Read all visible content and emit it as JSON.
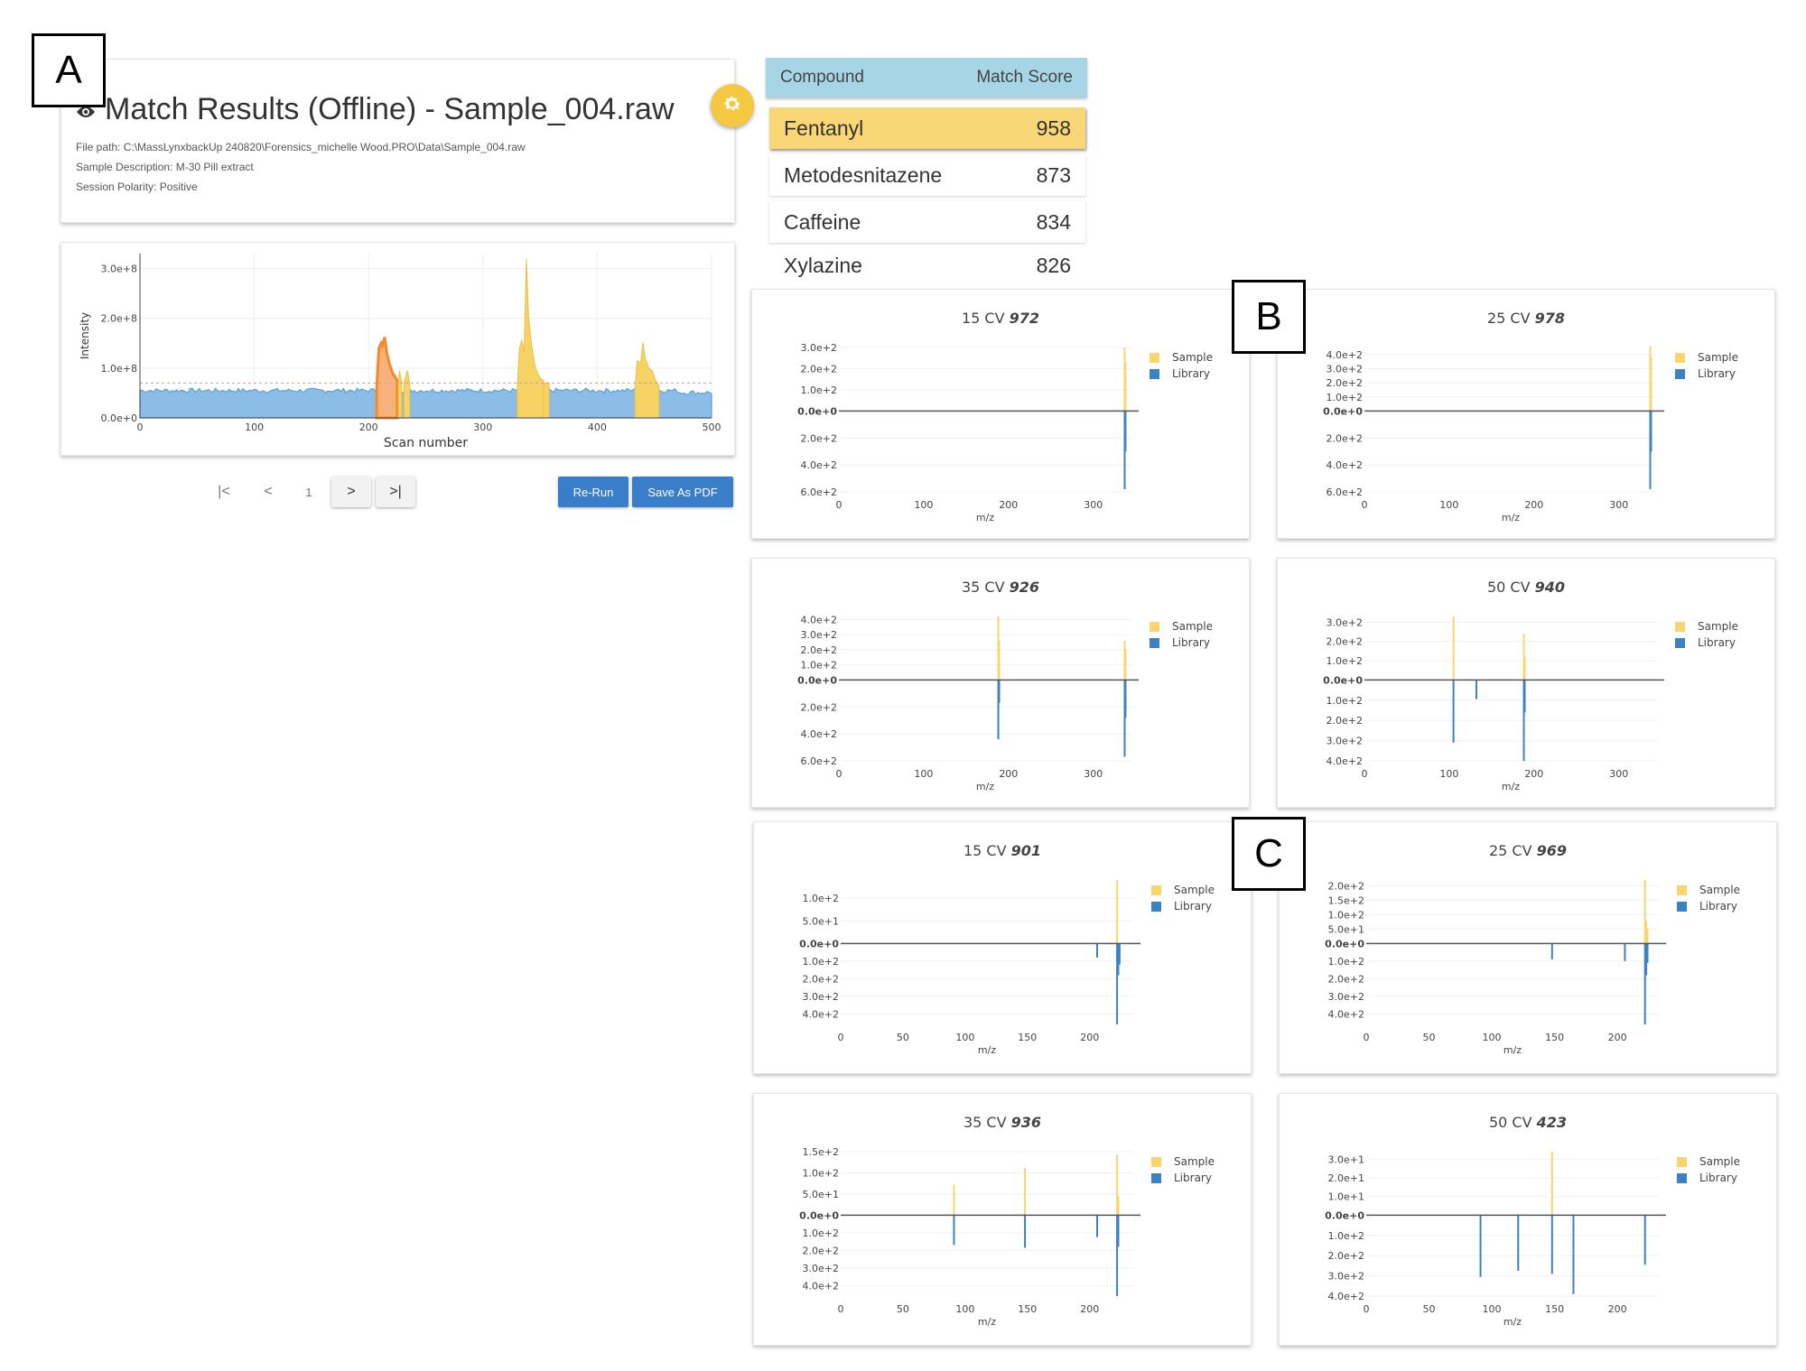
{
  "panel_labels": [
    "A",
    "B",
    "C"
  ],
  "header": {
    "title": "Match Results (Offline) - Sample_004.raw",
    "title_icon": "eye-icon",
    "file_path": "File path: C:\\MassLynxbackUp 240820\\Forensics_michelle Wood.PRO\\Data\\Sample_004.raw",
    "sample_description": "Sample Description: M-30 Pill extract",
    "session_polarity": "Session Polarity: Positive",
    "settings_icon": "gear-icon"
  },
  "colors": {
    "sample": "#f9d56e",
    "library": "#3b82c4",
    "chrom_base": "#8bbde6",
    "chrom_line": "#5a9fd6",
    "highlight_orange": "#f08a2c",
    "highlight_yellow": "#f7d264",
    "accent_button": "#3a7dc9",
    "table_header": "#a6d5e6",
    "selected_row": "#f9d777"
  },
  "pagination": {
    "first_icon": "first-page-icon",
    "prev_icon": "prev-page-icon",
    "current_page": "1",
    "next_icon": "next-page-icon",
    "last_icon": "last-page-icon"
  },
  "buttons": {
    "rerun": "Re-Run",
    "save_pdf": "Save As PDF"
  },
  "results_table": {
    "headers": [
      "Compound",
      "Match Score"
    ],
    "rows": [
      {
        "compound": "Fentanyl",
        "score": "958",
        "selected": true
      },
      {
        "compound": "Metodesnitazene",
        "score": "873",
        "selected": false
      },
      {
        "compound": "Caffeine",
        "score": "834",
        "selected": false
      },
      {
        "compound": "Xylazine",
        "score": "826",
        "selected": false
      }
    ]
  },
  "chart_data": [
    {
      "id": "chromatogram",
      "type": "area",
      "title": "",
      "xlabel": "Scan number",
      "ylabel": "Intensity",
      "xlim": [
        0,
        500
      ],
      "ylim": [
        0,
        330000000.0
      ],
      "xticks": [
        "0",
        "100",
        "200",
        "300",
        "400",
        "500"
      ],
      "yticks": [
        {
          "v": 0,
          "label": "0.0e+0"
        },
        {
          "v": 100000000.0,
          "label": "1.0e+8"
        },
        {
          "v": 200000000.0,
          "label": "2.0e+8"
        },
        {
          "v": 300000000.0,
          "label": "3.0e+8"
        }
      ],
      "threshold": 70000000.0,
      "baseline": 55000000.0,
      "grid": true,
      "highlight_regions": [
        {
          "start": 207,
          "end": 225,
          "color": "orange",
          "peak": [
            [
              207,
              60000000.0
            ],
            [
              209,
              140000000.0
            ],
            [
              211,
              150000000.0
            ],
            [
              212,
              145000000.0
            ],
            [
              214,
              162000000.0
            ],
            [
              216,
              130000000.0
            ],
            [
              218,
              110000000.0
            ],
            [
              221,
              90000000.0
            ],
            [
              225,
              75000000.0
            ]
          ]
        },
        {
          "start": 226,
          "end": 229,
          "color": "yellow",
          "peak": [
            [
              226,
              70000000.0
            ],
            [
              227,
              95000000.0
            ],
            [
              229,
              70000000.0
            ]
          ]
        },
        {
          "start": 231,
          "end": 236,
          "color": "yellow",
          "peak": [
            [
              231,
              70000000.0
            ],
            [
              234,
              95000000.0
            ],
            [
              236,
              70000000.0
            ]
          ]
        },
        {
          "start": 330,
          "end": 353,
          "color": "yellow",
          "peak": [
            [
              330,
              60000000.0
            ],
            [
              332,
              140000000.0
            ],
            [
              334,
              157000000.0
            ],
            [
              336,
              130000000.0
            ],
            [
              338,
              320000000.0
            ],
            [
              340,
              200000000.0
            ],
            [
              343,
              140000000.0
            ],
            [
              346,
              100000000.0
            ],
            [
              350,
              80000000.0
            ],
            [
              353,
              75000000.0
            ]
          ]
        },
        {
          "start": 353,
          "end": 358,
          "color": "yellow",
          "peak": [
            [
              353,
              70000000.0
            ],
            [
              356,
              70000000.0
            ],
            [
              358,
              70000000.0
            ]
          ]
        },
        {
          "start": 433,
          "end": 454,
          "color": "yellow",
          "peak": [
            [
              433,
              60000000.0
            ],
            [
              435,
              115000000.0
            ],
            [
              438,
              110000000.0
            ],
            [
              440,
              152000000.0
            ],
            [
              442,
              120000000.0
            ],
            [
              445,
              100000000.0
            ],
            [
              448,
              95000000.0
            ],
            [
              451,
              75000000.0
            ],
            [
              454,
              65000000.0
            ]
          ]
        }
      ]
    },
    {
      "id": "B-15CV",
      "type": "bar",
      "group": "B",
      "title_prefix": "15 CV",
      "score": "972",
      "xlabel": "m/z",
      "xlim": [
        0,
        345
      ],
      "xticks": [
        0,
        100,
        200,
        300
      ],
      "ylim_up": 300,
      "ylim_down": 600,
      "yticks_up": [
        {
          "v": 300,
          "label": "3.0e+2"
        },
        {
          "v": 200,
          "label": "2.0e+2"
        },
        {
          "v": 100,
          "label": "1.0e+2"
        }
      ],
      "yticks_down": [
        {
          "v": 200,
          "label": "2.0e+2"
        },
        {
          "v": 400,
          "label": "4.0e+2"
        },
        {
          "v": 600,
          "label": "6.0e+2",
          "offset_zero": true
        }
      ],
      "legend": [
        "Sample",
        "Library"
      ],
      "sample": [
        {
          "mz": 337,
          "i": 300
        },
        {
          "mz": 338,
          "i": 230
        }
      ],
      "library": [
        {
          "mz": 337,
          "i": 580
        },
        {
          "mz": 338,
          "i": 300
        }
      ]
    },
    {
      "id": "B-25CV",
      "type": "bar",
      "group": "B",
      "title_prefix": "25 CV",
      "score": "978",
      "xlabel": "m/z",
      "xlim": [
        0,
        345
      ],
      "xticks": [
        0,
        100,
        200,
        300
      ],
      "ylim_up": 450,
      "ylim_down": 600,
      "yticks_up": [
        {
          "v": 400,
          "label": "4.0e+2"
        },
        {
          "v": 300,
          "label": "3.0e+2"
        },
        {
          "v": 200,
          "label": "2.0e+2"
        },
        {
          "v": 100,
          "label": "1.0e+2"
        }
      ],
      "yticks_down": [
        {
          "v": 200,
          "label": "2.0e+2"
        },
        {
          "v": 400,
          "label": "4.0e+2"
        },
        {
          "v": 600,
          "label": "6.0e+2",
          "offset_zero": true
        }
      ],
      "legend": [
        "Sample",
        "Library"
      ],
      "sample": [
        {
          "mz": 337,
          "i": 460
        },
        {
          "mz": 338,
          "i": 380
        }
      ],
      "library": [
        {
          "mz": 337,
          "i": 580
        },
        {
          "mz": 338,
          "i": 300
        }
      ]
    },
    {
      "id": "B-35CV",
      "type": "bar",
      "group": "B",
      "title_prefix": "35 CV",
      "score": "926",
      "xlabel": "m/z",
      "xlim": [
        0,
        345
      ],
      "xticks": [
        0,
        100,
        200,
        300
      ],
      "ylim_up": 420,
      "ylim_down": 600,
      "yticks_up": [
        {
          "v": 400,
          "label": "4.0e+2"
        },
        {
          "v": 300,
          "label": "3.0e+2"
        },
        {
          "v": 200,
          "label": "2.0e+2"
        },
        {
          "v": 100,
          "label": "1.0e+2"
        }
      ],
      "yticks_down": [
        {
          "v": 200,
          "label": "2.0e+2"
        },
        {
          "v": 400,
          "label": "4.0e+2"
        },
        {
          "v": 600,
          "label": "6.0e+2",
          "offset_zero": true
        }
      ],
      "legend": [
        "Sample",
        "Library"
      ],
      "sample": [
        {
          "mz": 188,
          "i": 420
        },
        {
          "mz": 189,
          "i": 260
        },
        {
          "mz": 337,
          "i": 260
        },
        {
          "mz": 338,
          "i": 200
        }
      ],
      "library": [
        {
          "mz": 188,
          "i": 440
        },
        {
          "mz": 189,
          "i": 170
        },
        {
          "mz": 337,
          "i": 570
        },
        {
          "mz": 338,
          "i": 280
        }
      ]
    },
    {
      "id": "B-50CV",
      "type": "bar",
      "group": "B",
      "title_prefix": "50 CV",
      "score": "940",
      "xlabel": "m/z",
      "xlim": [
        0,
        345
      ],
      "xticks": [
        0,
        100,
        200,
        300
      ],
      "ylim_up": 330,
      "ylim_down": 400,
      "yticks_up": [
        {
          "v": 300,
          "label": "3.0e+2"
        },
        {
          "v": 200,
          "label": "2.0e+2"
        },
        {
          "v": 100,
          "label": "1.0e+2"
        }
      ],
      "yticks_down": [
        {
          "v": 100,
          "label": "1.0e+2"
        },
        {
          "v": 200,
          "label": "2.0e+2"
        },
        {
          "v": 300,
          "label": "3.0e+2"
        },
        {
          "v": 400,
          "label": "4.0e+2"
        }
      ],
      "legend": [
        "Sample",
        "Library"
      ],
      "sample": [
        {
          "mz": 105,
          "i": 330
        },
        {
          "mz": 188,
          "i": 240
        },
        {
          "mz": 189,
          "i": 120
        }
      ],
      "library": [
        {
          "mz": 105,
          "i": 310
        },
        {
          "mz": 132,
          "i": 95
        },
        {
          "mz": 188,
          "i": 400
        },
        {
          "mz": 189,
          "i": 160
        }
      ]
    },
    {
      "id": "C-15CV",
      "type": "bar",
      "group": "C",
      "title_prefix": "15 CV",
      "score": "901",
      "xlabel": "m/z",
      "xlim": [
        0,
        235
      ],
      "xticks": [
        0,
        50,
        100,
        150,
        200
      ],
      "ylim_up": 140,
      "ylim_down": 460,
      "yticks_up": [
        {
          "v": 100,
          "label": "1.0e+2"
        },
        {
          "v": 50,
          "label": "5.0e+1"
        }
      ],
      "yticks_down": [
        {
          "v": 100,
          "label": "1.0e+2"
        },
        {
          "v": 200,
          "label": "2.0e+2"
        },
        {
          "v": 300,
          "label": "3.0e+2"
        },
        {
          "v": 400,
          "label": "4.0e+2"
        }
      ],
      "legend": [
        "Sample",
        "Library"
      ],
      "sample": [
        {
          "mz": 222,
          "i": 140
        }
      ],
      "library": [
        {
          "mz": 206,
          "i": 80
        },
        {
          "mz": 222,
          "i": 460
        },
        {
          "mz": 223,
          "i": 180
        },
        {
          "mz": 224,
          "i": 120
        }
      ]
    },
    {
      "id": "C-25CV",
      "type": "bar",
      "group": "C",
      "title_prefix": "25 CV",
      "score": "969",
      "xlabel": "m/z",
      "xlim": [
        0,
        233
      ],
      "xticks": [
        0,
        50,
        100,
        150,
        200
      ],
      "ylim_up": 220,
      "ylim_down": 460,
      "yticks_up": [
        {
          "v": 200,
          "label": "2.0e+2"
        },
        {
          "v": 150,
          "label": "1.5e+2"
        },
        {
          "v": 100,
          "label": "1.0e+2"
        },
        {
          "v": 50,
          "label": "5.0e+1"
        }
      ],
      "yticks_down": [
        {
          "v": 100,
          "label": "1.0e+2"
        },
        {
          "v": 200,
          "label": "2.0e+2"
        },
        {
          "v": 300,
          "label": "3.0e+2"
        },
        {
          "v": 400,
          "label": "4.0e+2"
        }
      ],
      "legend": [
        "Sample",
        "Library"
      ],
      "sample": [
        {
          "mz": 222,
          "i": 220
        },
        {
          "mz": 223,
          "i": 80
        },
        {
          "mz": 224,
          "i": 50
        }
      ],
      "library": [
        {
          "mz": 148,
          "i": 90
        },
        {
          "mz": 206,
          "i": 100
        },
        {
          "mz": 222,
          "i": 460
        },
        {
          "mz": 223,
          "i": 180
        },
        {
          "mz": 224,
          "i": 110
        }
      ]
    },
    {
      "id": "C-35CV",
      "type": "bar",
      "group": "C",
      "title_prefix": "35 CV",
      "score": "936",
      "xlabel": "m/z",
      "xlim": [
        0,
        235
      ],
      "xticks": [
        0,
        50,
        100,
        150,
        200
      ],
      "ylim_up": 150,
      "ylim_down": 460,
      "yticks_up": [
        {
          "v": 150,
          "label": "1.5e+2"
        },
        {
          "v": 100,
          "label": "1.0e+2"
        },
        {
          "v": 50,
          "label": "5.0e+1"
        }
      ],
      "yticks_down": [
        {
          "v": 100,
          "label": "1.0e+2"
        },
        {
          "v": 200,
          "label": "2.0e+2"
        },
        {
          "v": 300,
          "label": "3.0e+2"
        },
        {
          "v": 400,
          "label": "4.0e+2"
        }
      ],
      "legend": [
        "Sample",
        "Library"
      ],
      "sample": [
        {
          "mz": 91,
          "i": 72
        },
        {
          "mz": 148,
          "i": 112
        },
        {
          "mz": 222,
          "i": 143
        },
        {
          "mz": 223,
          "i": 45
        }
      ],
      "library": [
        {
          "mz": 91,
          "i": 170
        },
        {
          "mz": 148,
          "i": 185
        },
        {
          "mz": 206,
          "i": 125
        },
        {
          "mz": 222,
          "i": 460
        },
        {
          "mz": 223,
          "i": 180
        }
      ]
    },
    {
      "id": "C-50CV",
      "type": "bar",
      "group": "C",
      "title_prefix": "50 CV",
      "score": "423",
      "xlabel": "m/z",
      "xlim": [
        0,
        233
      ],
      "xticks": [
        0,
        50,
        100,
        150,
        200
      ],
      "ylim_up": 34,
      "ylim_down": 400,
      "yticks_up": [
        {
          "v": 30,
          "label": "3.0e+1"
        },
        {
          "v": 20,
          "label": "2.0e+1"
        },
        {
          "v": 10,
          "label": "1.0e+1"
        }
      ],
      "yticks_down": [
        {
          "v": 100,
          "label": "1.0e+2"
        },
        {
          "v": 200,
          "label": "2.0e+2"
        },
        {
          "v": 300,
          "label": "3.0e+2"
        },
        {
          "v": 400,
          "label": "4.0e+2",
          "offset_zero": true
        }
      ],
      "legend": [
        "Sample",
        "Library"
      ],
      "sample": [
        {
          "mz": 148,
          "i": 34
        }
      ],
      "library": [
        {
          "mz": 91,
          "i": 305
        },
        {
          "mz": 121,
          "i": 275
        },
        {
          "mz": 148,
          "i": 290
        },
        {
          "mz": 165,
          "i": 390
        },
        {
          "mz": 222,
          "i": 245
        }
      ]
    }
  ]
}
